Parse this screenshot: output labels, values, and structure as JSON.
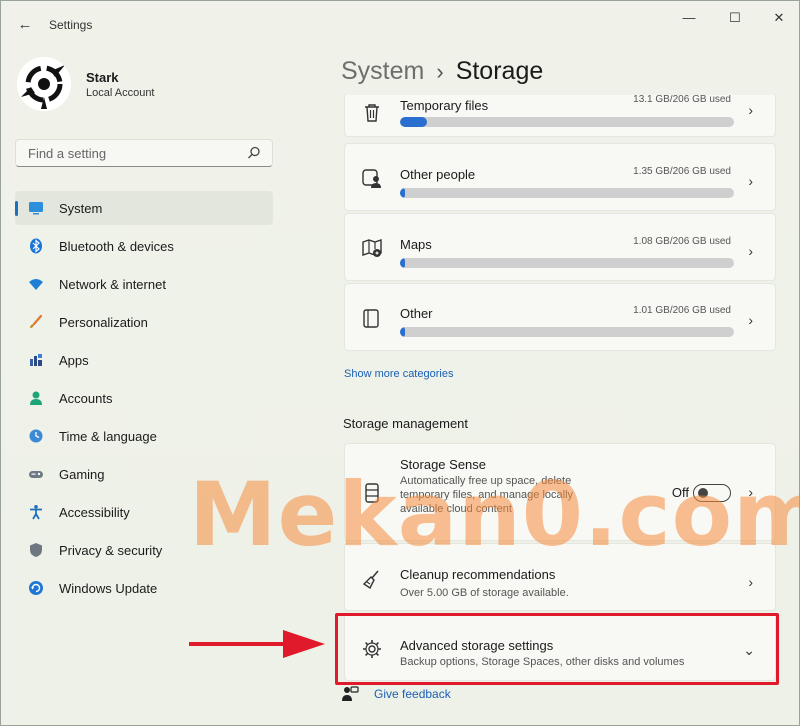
{
  "window": {
    "app_title": "Settings",
    "back_glyph": "←",
    "minimize_glyph": "—",
    "maximize_glyph": "☐",
    "close_glyph": "✕"
  },
  "profile": {
    "name": "Stark",
    "account_type": "Local Account"
  },
  "search": {
    "placeholder": "Find a setting"
  },
  "sidebar": {
    "items": [
      {
        "label": "System",
        "icon": "monitor-icon",
        "active": true
      },
      {
        "label": "Bluetooth & devices",
        "icon": "bluetooth-icon"
      },
      {
        "label": "Network & internet",
        "icon": "wifi-icon"
      },
      {
        "label": "Personalization",
        "icon": "brush-icon"
      },
      {
        "label": "Apps",
        "icon": "apps-icon"
      },
      {
        "label": "Accounts",
        "icon": "person-icon"
      },
      {
        "label": "Time & language",
        "icon": "globe-clock-icon"
      },
      {
        "label": "Gaming",
        "icon": "gamepad-icon"
      },
      {
        "label": "Accessibility",
        "icon": "accessibility-icon"
      },
      {
        "label": "Privacy & security",
        "icon": "shield-icon"
      },
      {
        "label": "Windows Update",
        "icon": "update-icon"
      }
    ]
  },
  "header": {
    "parent": "System",
    "separator": "›",
    "current": "Storage"
  },
  "storage_categories": [
    {
      "title": "Temporary files",
      "used": "13.1 GB/206 GB used",
      "fraction": 0.08,
      "icon": "trash-icon"
    },
    {
      "title": "Other people",
      "used": "1.35 GB/206 GB used",
      "fraction": 0.01,
      "icon": "people-icon"
    },
    {
      "title": "Maps",
      "used": "1.08 GB/206 GB used",
      "fraction": 0.01,
      "icon": "map-icon"
    },
    {
      "title": "Other",
      "used": "1.01 GB/206 GB used",
      "fraction": 0.01,
      "icon": "document-icon"
    }
  ],
  "show_more_link": "Show more categories",
  "storage_management": {
    "section_title": "Storage management",
    "storage_sense": {
      "title": "Storage Sense",
      "description": "Automatically free up space, delete temporary files, and manage locally available cloud content",
      "toggle_label": "Off",
      "toggle_on": false
    },
    "cleanup": {
      "title": "Cleanup recommendations",
      "description": "Over 5.00 GB of storage available."
    },
    "advanced": {
      "title": "Advanced storage settings",
      "description": "Backup options, Storage Spaces, other disks and volumes"
    }
  },
  "feedback_link": "Give feedback",
  "watermark": "Mekan0.com",
  "colors": {
    "accent": "#1f6fbf",
    "highlight_box": "#e01a2b",
    "arrow": "#e01a2b",
    "bar_fill": "#2a6fd0"
  }
}
